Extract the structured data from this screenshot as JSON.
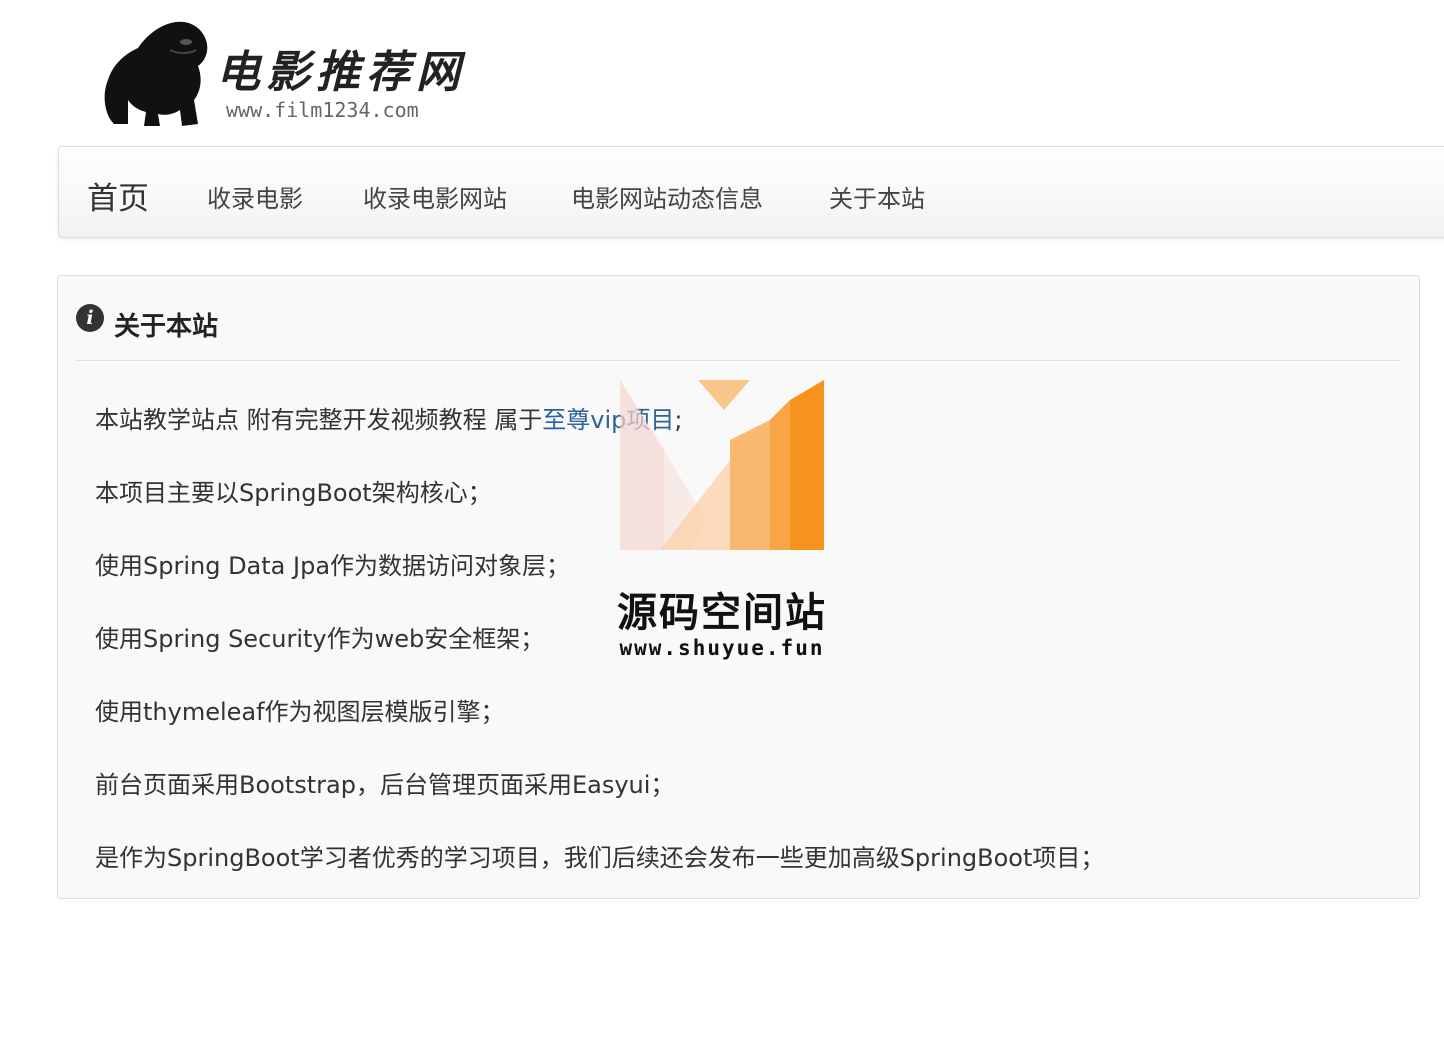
{
  "header": {
    "logo_title": "电影推荐网",
    "logo_url": "www.film1234.com"
  },
  "navbar": {
    "brand": "首页",
    "items": [
      {
        "label": "收录电影"
      },
      {
        "label": "收录电影网站"
      },
      {
        "label": "电影网站动态信息"
      },
      {
        "label": "关于本站"
      }
    ]
  },
  "panel": {
    "icon": "info-icon",
    "title": "关于本站",
    "p1_prefix": "本站教学站点 附有完整开发视频教程 属于",
    "p1_link": "至尊vip项目",
    "p1_suffix": ";",
    "paragraphs": [
      "本项目主要以SpringBoot架构核心；",
      "使用Spring Data Jpa作为数据访问对象层；",
      "使用Spring Security作为web安全框架；",
      "使用thymeleaf作为视图层模版引擎；",
      "前台页面采用Bootstrap，后台管理页面采用Easyui；",
      "是作为SpringBoot学习者优秀的学习项目，我们后续还会发布一些更加高级SpringBoot项目；"
    ]
  },
  "watermark": {
    "name": "源码空间站",
    "url": "www.shuyue.fun",
    "colors": {
      "orange": "#f7941d",
      "light": "#f5d6d0"
    }
  }
}
